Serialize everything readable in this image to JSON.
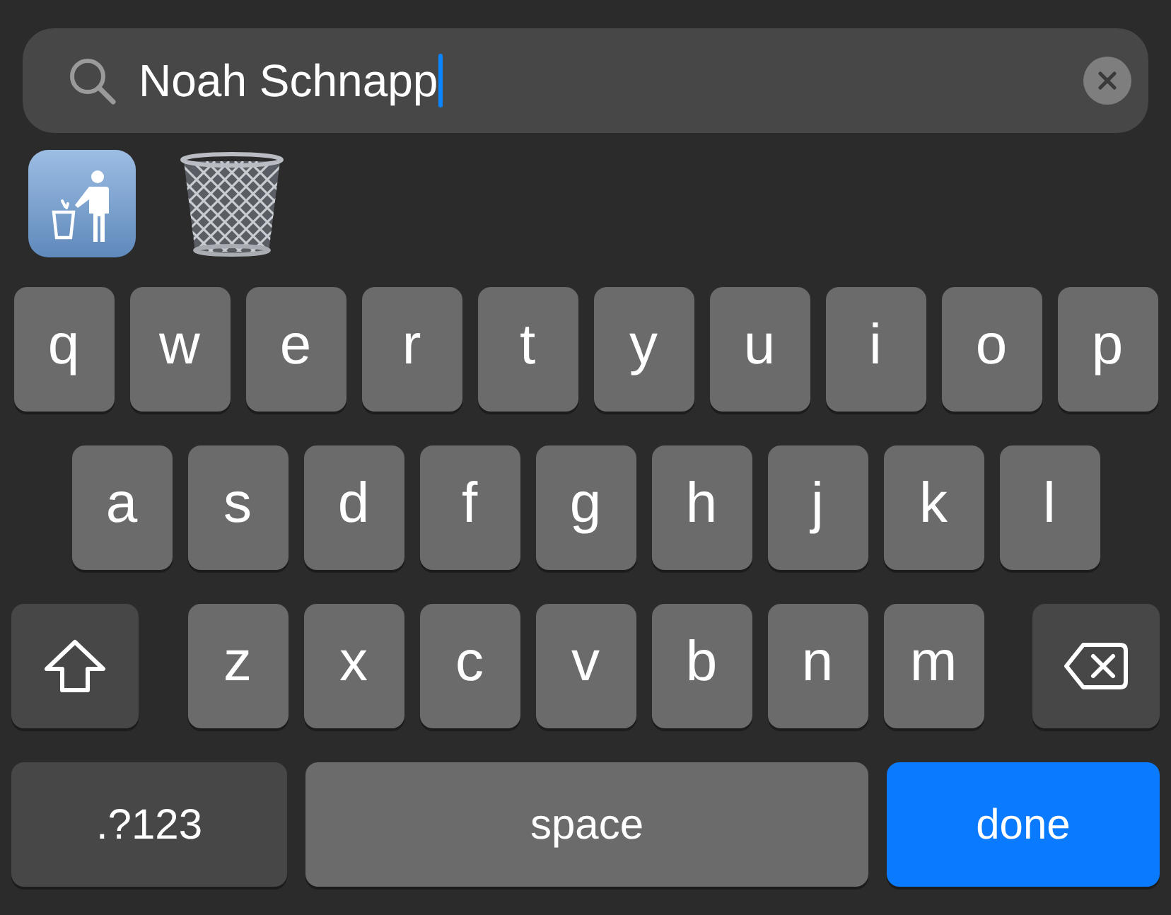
{
  "search": {
    "value": "Noah Schnapp"
  },
  "keyboard": {
    "rows": [
      {
        "keys": [
          {
            "kind": "letter",
            "label": "q"
          },
          {
            "kind": "letter",
            "label": "w"
          },
          {
            "kind": "letter",
            "label": "e"
          },
          {
            "kind": "letter",
            "label": "r"
          },
          {
            "kind": "letter",
            "label": "t"
          },
          {
            "kind": "letter",
            "label": "y"
          },
          {
            "kind": "letter",
            "label": "u"
          },
          {
            "kind": "letter",
            "label": "i"
          },
          {
            "kind": "letter",
            "label": "o"
          },
          {
            "kind": "letter",
            "label": "p"
          }
        ]
      },
      {
        "keys": [
          {
            "kind": "letter",
            "label": "a"
          },
          {
            "kind": "letter",
            "label": "s"
          },
          {
            "kind": "letter",
            "label": "d"
          },
          {
            "kind": "letter",
            "label": "f"
          },
          {
            "kind": "letter",
            "label": "g"
          },
          {
            "kind": "letter",
            "label": "h"
          },
          {
            "kind": "letter",
            "label": "j"
          },
          {
            "kind": "letter",
            "label": "k"
          },
          {
            "kind": "letter",
            "label": "l"
          }
        ]
      },
      {
        "keys": [
          {
            "kind": "shift"
          },
          {
            "kind": "letter",
            "label": "z"
          },
          {
            "kind": "letter",
            "label": "x"
          },
          {
            "kind": "letter",
            "label": "c"
          },
          {
            "kind": "letter",
            "label": "v"
          },
          {
            "kind": "letter",
            "label": "b"
          },
          {
            "kind": "letter",
            "label": "n"
          },
          {
            "kind": "letter",
            "label": "m"
          },
          {
            "kind": "delete"
          }
        ]
      },
      {
        "keys": [
          {
            "kind": "mode",
            "label": ".?123"
          },
          {
            "kind": "space",
            "label": "space"
          },
          {
            "kind": "return",
            "label": "done"
          }
        ]
      }
    ]
  }
}
